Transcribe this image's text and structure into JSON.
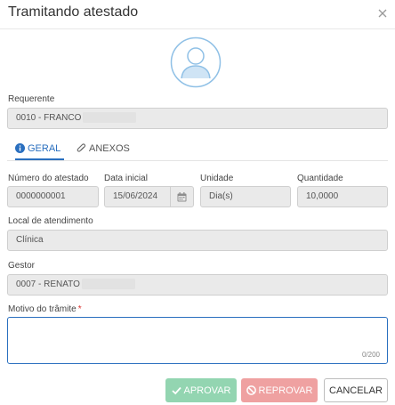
{
  "dialog": {
    "title": "Tramitando atestado",
    "close_icon": "close-icon"
  },
  "avatar": {
    "icon": "user-avatar-icon"
  },
  "requerente": {
    "label": "Requerente",
    "value": "0010 - FRANCO"
  },
  "tabs": [
    {
      "label": "GERAL",
      "icon": "info-circle-icon",
      "active": true
    },
    {
      "label": "ANEXOS",
      "icon": "paperclip-icon",
      "active": false
    }
  ],
  "fields": {
    "numero": {
      "label": "Número do atestado",
      "value": "0000000001"
    },
    "data_inicial": {
      "label": "Data inicial",
      "value": "15/06/2024"
    },
    "unidade": {
      "label": "Unidade",
      "value": "Dia(s)"
    },
    "quantidade": {
      "label": "Quantidade",
      "value": "10,0000"
    },
    "local": {
      "label": "Local de atendimento",
      "value": "Clínica"
    },
    "gestor": {
      "label": "Gestor",
      "value": "0007 - RENATO"
    },
    "motivo": {
      "label": "Motivo do trâmite",
      "required_mark": "*",
      "value": "",
      "counter": "0/200"
    }
  },
  "buttons": {
    "aprovar": "APROVAR",
    "reprovar": "REPROVAR",
    "cancelar": "CANCELAR"
  },
  "colors": {
    "accent": "#2a6fbf",
    "approve": "#93d5b1",
    "reject": "#efa1a1",
    "required": "#d9302b"
  }
}
